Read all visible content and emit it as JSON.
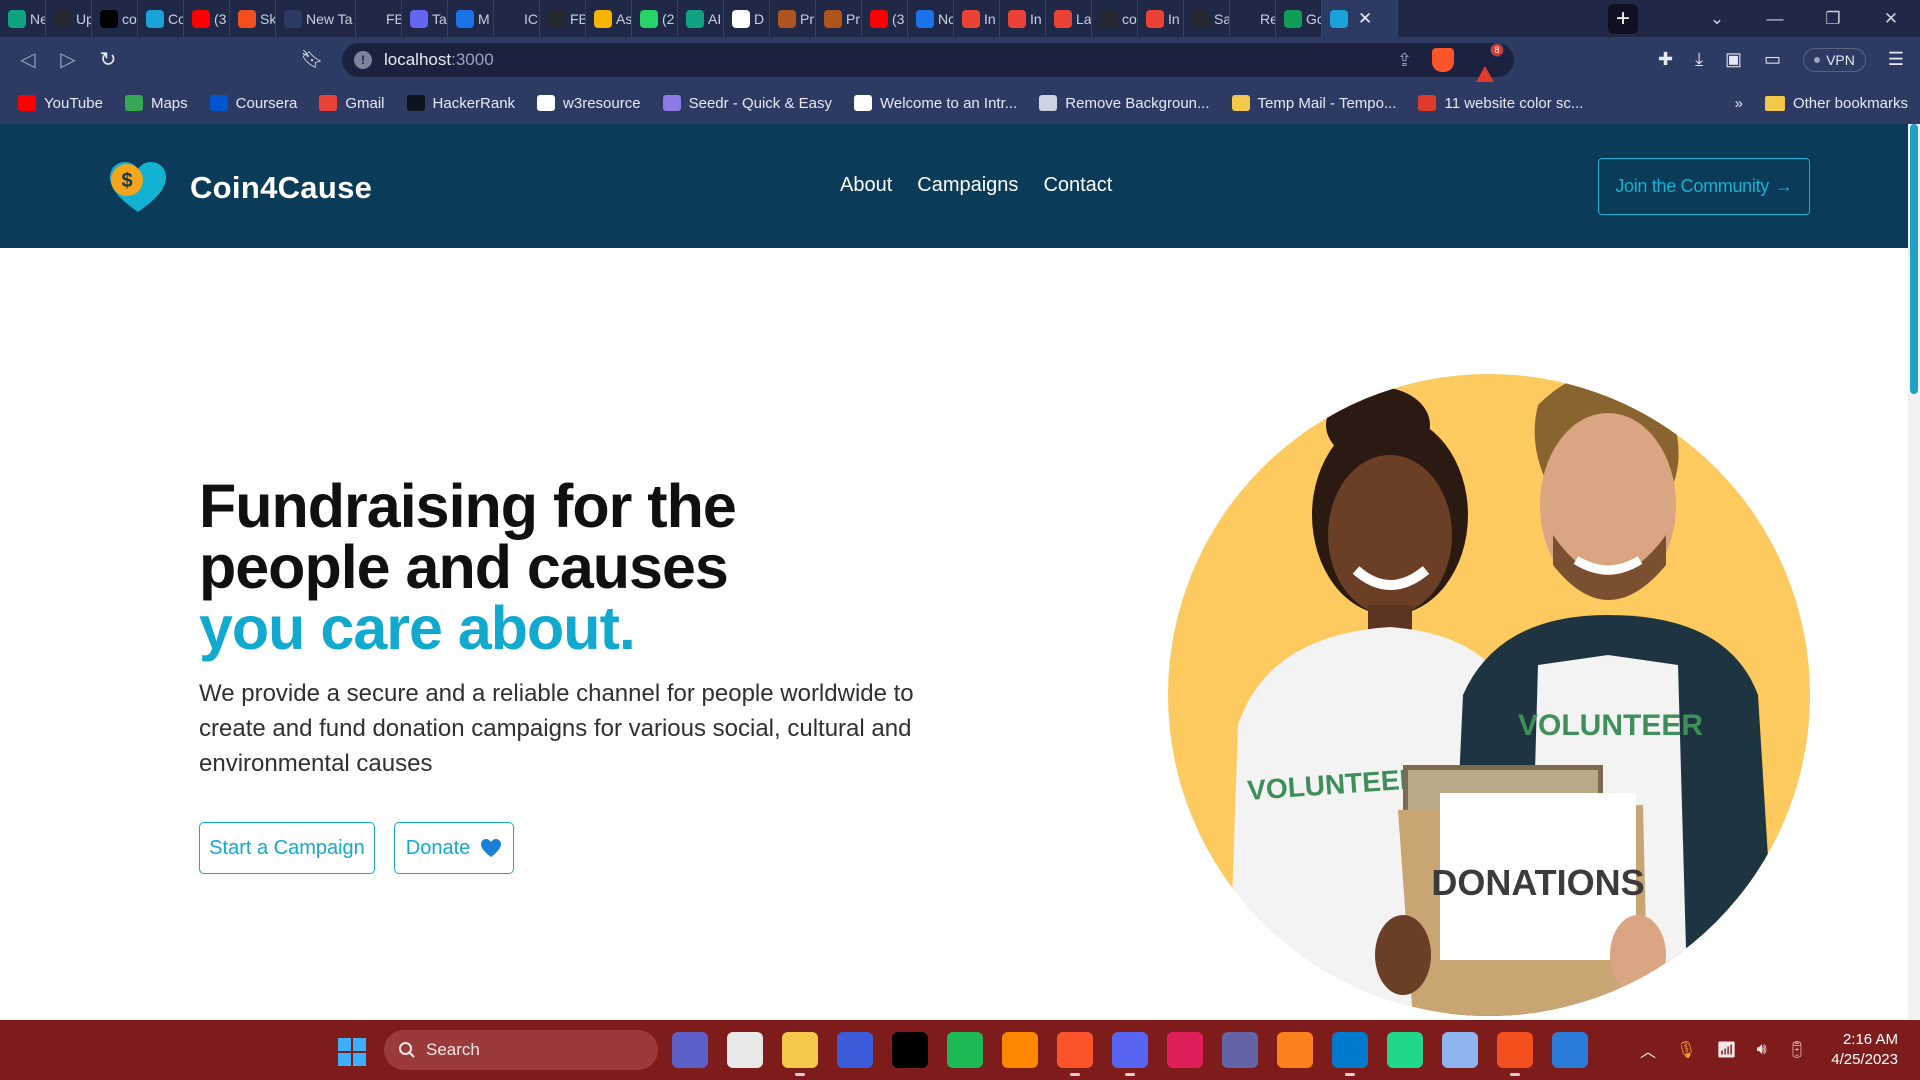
{
  "browser": {
    "tabs": [
      {
        "label": "Ne",
        "icon": "chatgpt-icon",
        "color": "#10a37f"
      },
      {
        "label": "Up",
        "icon": "github-icon",
        "color": "#24292f"
      },
      {
        "label": "co",
        "icon": "vercel-icon",
        "color": "#000000"
      },
      {
        "label": "Cc",
        "icon": "heart-icon",
        "color": "#1aa3d8"
      },
      {
        "label": "(3",
        "icon": "youtube-icon",
        "color": "#ff0000"
      },
      {
        "label": "Sk",
        "icon": "figma-icon",
        "color": "#f24e1e"
      },
      {
        "label": "New Ta",
        "icon": "newtab-icon",
        "color": "#2d3a63"
      },
      {
        "label": "FB",
        "icon": "react-icon",
        "color": "#1f2947"
      },
      {
        "label": "Ta",
        "icon": "tailwind-icon",
        "color": "#6366f1"
      },
      {
        "label": "M",
        "icon": "mdn-icon",
        "color": "#1a73e8"
      },
      {
        "label": "IC",
        "icon": "blank-icon",
        "color": "#1f2947"
      },
      {
        "label": "FB",
        "icon": "github-icon",
        "color": "#24292f"
      },
      {
        "label": "As",
        "icon": "notes-icon",
        "color": "#f4b400"
      },
      {
        "label": "(2",
        "icon": "whatsapp-icon",
        "color": "#25d366"
      },
      {
        "label": "AI",
        "icon": "openai-icon",
        "color": "#10a37f"
      },
      {
        "label": "D",
        "icon": "doc-icon",
        "color": "#ffffff"
      },
      {
        "label": "Pr",
        "icon": "brush-icon",
        "color": "#b0541d"
      },
      {
        "label": "Pr",
        "icon": "brush-icon",
        "color": "#b0541d"
      },
      {
        "label": "(3",
        "icon": "youtube-icon",
        "color": "#ff0000"
      },
      {
        "label": "Nc",
        "icon": "mdn-icon",
        "color": "#1a73e8"
      },
      {
        "label": "In",
        "icon": "gmail-icon",
        "color": "#ea4335"
      },
      {
        "label": "In",
        "icon": "gmail-icon",
        "color": "#ea4335"
      },
      {
        "label": "La",
        "icon": "gmail-icon",
        "color": "#ea4335"
      },
      {
        "label": "co",
        "icon": "github-icon",
        "color": "#24292f"
      },
      {
        "label": "In",
        "icon": "gmail-icon",
        "color": "#ea4335"
      },
      {
        "label": "Sa",
        "icon": "github-icon",
        "color": "#24292f"
      },
      {
        "label": "Re",
        "icon": "react-icon",
        "color": "#1f2947"
      },
      {
        "label": "Gc",
        "icon": "drive-icon",
        "color": "#0f9d58"
      }
    ],
    "url_host": "localhost",
    "url_port": ":3000",
    "vpn_label": "VPN",
    "rewards_count": "8",
    "bookmarks": [
      {
        "label": "YouTube",
        "icon": "youtube-icon",
        "color": "#ff0000"
      },
      {
        "label": "Maps",
        "icon": "maps-icon",
        "color": "#34a853"
      },
      {
        "label": "Coursera",
        "icon": "coursera-icon",
        "color": "#0056d2"
      },
      {
        "label": "Gmail",
        "icon": "gmail-icon",
        "color": "#ea4335"
      },
      {
        "label": "HackerRank",
        "icon": "hackerrank-icon",
        "color": "#0e141e"
      },
      {
        "label": "w3resource",
        "icon": "w3resource-icon",
        "color": "#ffffff"
      },
      {
        "label": "Seedr - Quick & Easy",
        "icon": "seedr-icon",
        "color": "#8d7ae6"
      },
      {
        "label": "Welcome to an Intr...",
        "icon": "stairs-icon",
        "color": "#ffffff"
      },
      {
        "label": "Remove Backgroun...",
        "icon": "layers-icon",
        "color": "#cfd3df"
      },
      {
        "label": "Temp Mail - Tempo...",
        "icon": "mail-icon",
        "color": "#f4c84a"
      },
      {
        "label": "11 website color sc...",
        "icon": "palette-icon",
        "color": "#e03a2d"
      }
    ],
    "bookmarks_overflow": "»",
    "other_bookmarks": "Other bookmarks"
  },
  "site": {
    "brand": "Coin4Cause",
    "logo_symbol": "$",
    "nav": [
      "About",
      "Campaigns",
      "Contact"
    ],
    "join_button": "Join the Community",
    "join_arrow": "→"
  },
  "hero": {
    "title_line1": "Fundraising for the",
    "title_line2": "people and causes",
    "title_accent": "you care about.",
    "subtitle": "We provide a secure and a reliable channel for people worldwide to create and fund donation campaigns for various social, cultural and environmental causes",
    "start_button": "Start a Campaign",
    "donate_button": "Donate",
    "image_text_left_shirt": "VOLUNTEER",
    "image_text_right_shirt": "VOLUNTEER",
    "image_text_box": "DONATIONS"
  },
  "taskbar": {
    "search_label": "Search",
    "apps": [
      {
        "name": "meet-icon",
        "color": "#5b5fc7",
        "running": false
      },
      {
        "name": "store-icon",
        "color": "#e8e8e8",
        "running": false
      },
      {
        "name": "file-explorer-icon",
        "color": "#f4c84a",
        "running": true
      },
      {
        "name": "mathpix-icon",
        "color": "#3b5bdb",
        "running": false
      },
      {
        "name": "netflix-icon",
        "color": "#000000",
        "running": false
      },
      {
        "name": "spotify-icon",
        "color": "#1db954",
        "running": false
      },
      {
        "name": "vlc-icon",
        "color": "#ff8800",
        "running": false
      },
      {
        "name": "brave-icon",
        "color": "#fb542b",
        "running": true
      },
      {
        "name": "discord-icon",
        "color": "#5865f2",
        "running": true
      },
      {
        "name": "slack-icon",
        "color": "#e01e5a",
        "running": false
      },
      {
        "name": "teams-icon",
        "color": "#6264a7",
        "running": false
      },
      {
        "name": "intellij-icon",
        "color": "#fc801d",
        "running": false
      },
      {
        "name": "vscode-icon",
        "color": "#007acc",
        "running": true
      },
      {
        "name": "pycharm-icon",
        "color": "#21d789",
        "running": false
      },
      {
        "name": "virtualbox-icon",
        "color": "#8fb4f0",
        "running": false
      },
      {
        "name": "figma-icon",
        "color": "#f24e1e",
        "running": true
      },
      {
        "name": "wps-icon",
        "color": "#2b7bd8",
        "running": false
      }
    ],
    "time": "2:16 AM",
    "date": "4/25/2023"
  }
}
